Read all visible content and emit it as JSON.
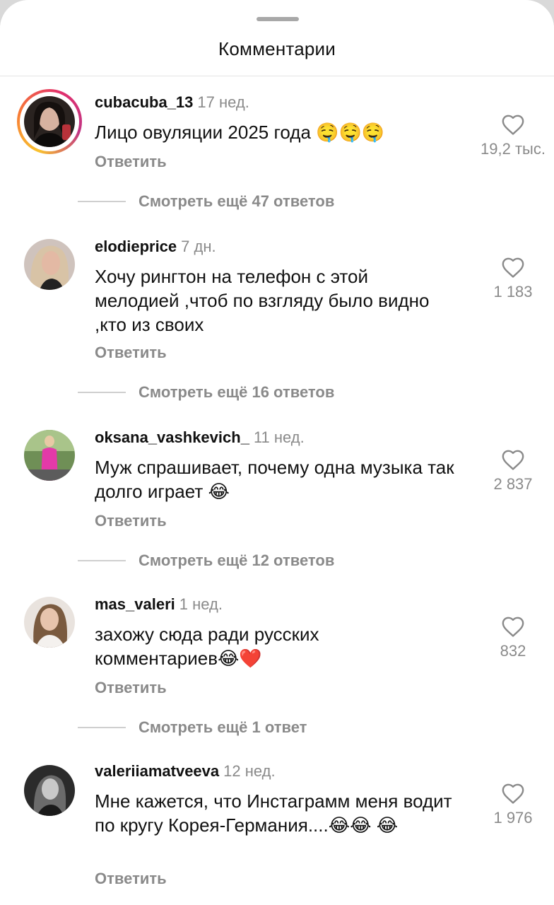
{
  "header": {
    "title": "Комментарии"
  },
  "comments": [
    {
      "user": "cubacuba_13",
      "time": "17 нед.",
      "text": "Лицо овуляции 2025 года 🤤🤤🤤",
      "reply": "Ответить",
      "likes": "19,2 тыс.",
      "more": "Смотреть ещё 47 ответов"
    },
    {
      "user": "elodieprice",
      "time": "7 дн.",
      "text": "Хочу рингтон на телефон с этой мелодией ,чтоб по взгляду было видно ,кто из своих",
      "reply": "Ответить",
      "likes": "1 183",
      "more": "Смотреть ещё 16 ответов"
    },
    {
      "user": "oksana_vashkevich_",
      "time": "11 нед.",
      "text": "Муж спрашивает, почему одна музыка так долго играет 😂",
      "reply": "Ответить",
      "likes": "2 837",
      "more": "Смотреть ещё 12 ответов"
    },
    {
      "user": "mas_valeri",
      "time": "1 нед.",
      "text": "захожу сюда ради русских комментариев😂❤️",
      "reply": "Ответить",
      "likes": "832",
      "more": "Смотреть ещё 1 ответ"
    },
    {
      "user": "valeriiamatveeva",
      "time": "12 нед.",
      "text": "Мне кажется, что Инстаграмм меня водит по кругу Корея-Германия....😂😂 😂",
      "reply": "Ответить",
      "likes": "1 976"
    }
  ],
  "colors": {
    "secondary_text": "#8a8a8a",
    "primary_text": "#111111",
    "story_ring": "#e1306c"
  },
  "icons": {
    "like": "heart-outline-icon"
  }
}
